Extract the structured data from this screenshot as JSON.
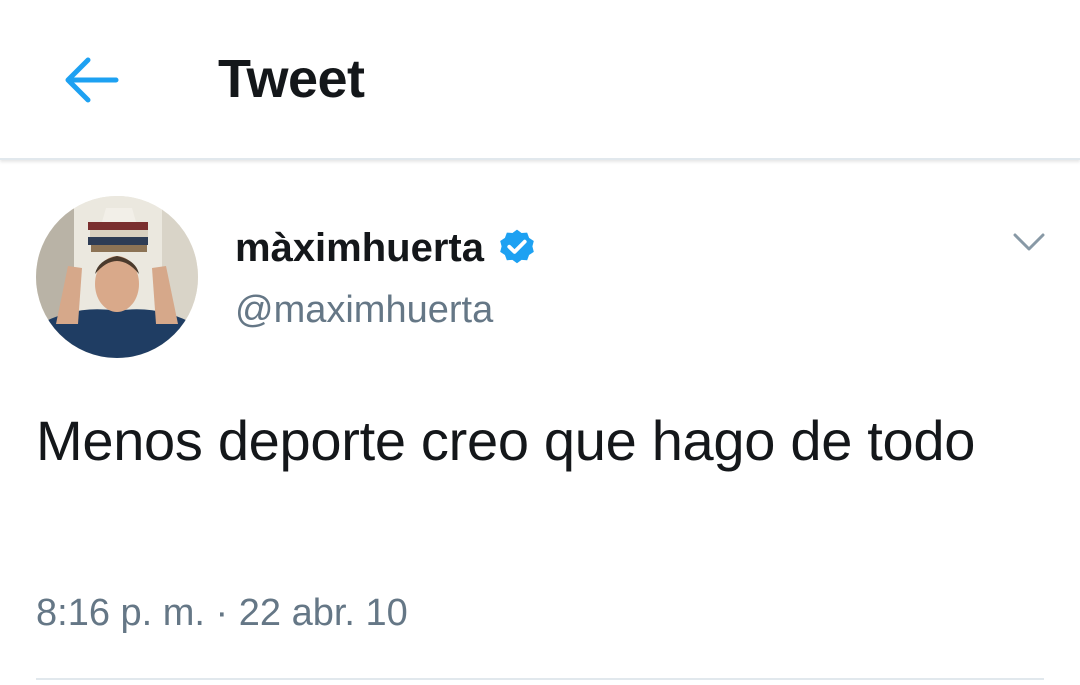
{
  "header": {
    "title": "Tweet",
    "back_icon": "arrow-left-icon"
  },
  "tweet": {
    "author_name": "màximhuerta",
    "verified_icon": "verified-badge-icon",
    "handle": "@maximhuerta",
    "text": "Menos deporte creo que hago de todo",
    "time": "8:16 p. m.",
    "separator": "·",
    "date": "22 abr. 10",
    "menu_icon": "chevron-down-icon"
  },
  "colors": {
    "accent": "#1da1f2",
    "text_primary": "#14171a",
    "text_secondary": "#657786",
    "divider": "#e1e8ed"
  }
}
